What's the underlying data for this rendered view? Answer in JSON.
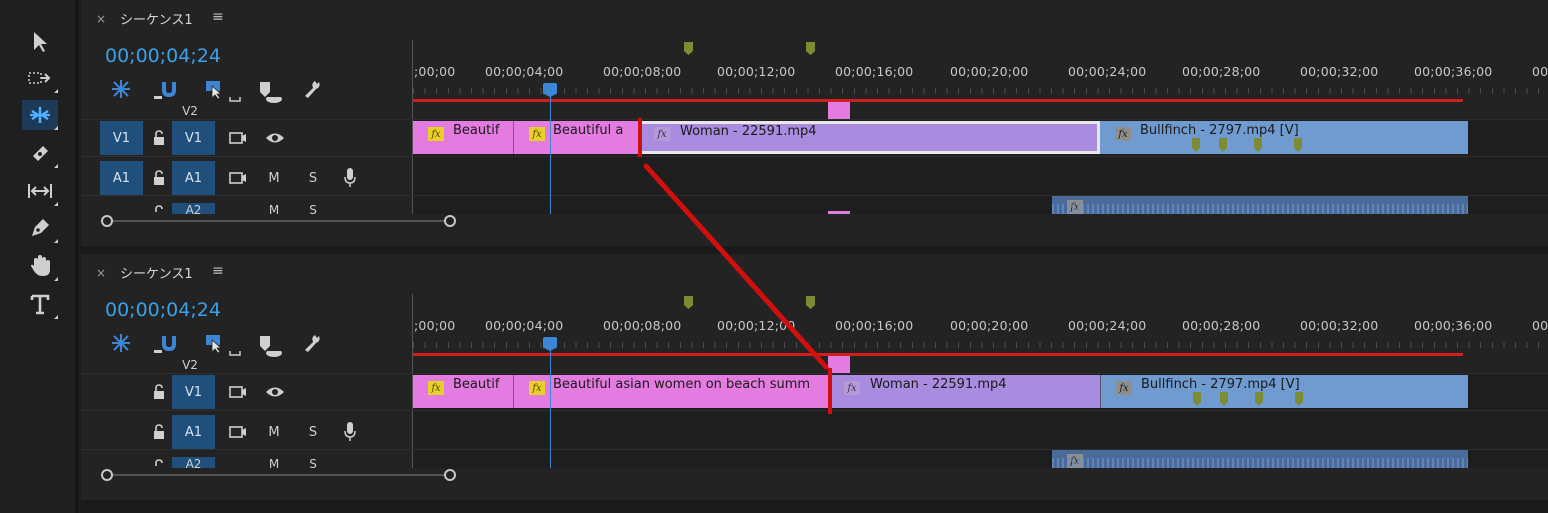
{
  "sequences": [
    {
      "tab_title": "シーケンス1",
      "timecode": "00;00;04;24",
      "ruler": [
        ";00;00",
        "00;00;04;00",
        "00;00;08;00",
        "00;00;12;00",
        "00;00;16;00",
        "00;00;20;00",
        "00;00;24;00",
        "00;00;28;00",
        "00;00;32;00",
        "00;00;36;00",
        "00;"
      ],
      "tracks": {
        "v2": "V2",
        "v1_src": "V1",
        "v1": "V1",
        "a1_src": "A1",
        "a1": "A1",
        "a2": "A2",
        "mute": "M",
        "solo": "S"
      },
      "clips": {
        "c1": "Beautif",
        "c2": "Beautiful a",
        "c3": "Woman - 22591.mp4",
        "c4": "Bullfinch - 2797.mp4 [V]"
      }
    },
    {
      "tab_title": "シーケンス1",
      "timecode": "00;00;04;24",
      "ruler": [
        ";00;00",
        "00;00;04;00",
        "00;00;08;00",
        "00;00;12;00",
        "00;00;16;00",
        "00;00;20;00",
        "00;00;24;00",
        "00;00;28;00",
        "00;00;32;00",
        "00;00;36;00",
        "00;"
      ],
      "tracks": {
        "v2": "V2",
        "v1": "V1",
        "a1": "A1",
        "a2": "A2",
        "mute": "M",
        "solo": "S"
      },
      "clips": {
        "c1": "Beautif",
        "c2": "Beautiful asian women on beach summ",
        "c3": "Woman - 22591.mp4",
        "c4": "Bullfinch - 2797.mp4 [V]"
      }
    }
  ],
  "common": {
    "close": "×",
    "menu": "≡",
    "fx": "fx"
  },
  "icons": [
    "selection-tool-icon",
    "track-select-forward-icon",
    "ripple-edit-icon",
    "razor-tool-icon",
    "slip-tool-icon",
    "pen-tool-icon",
    "hand-tool-icon",
    "type-tool-icon",
    "nest-icon",
    "snap-icon",
    "linked-selection-icon",
    "add-marker-icon",
    "wrench-icon",
    "lock-icon",
    "toggle-output-icon",
    "eye-icon",
    "microphone-icon"
  ],
  "colors": {
    "accent": "#3aa0e8",
    "pink_clip": "#e37be0",
    "purple_clip": "#a98ce0",
    "blue_clip": "#6f9bd0",
    "marker": "#7b8c34",
    "red": "#d11e1e"
  }
}
